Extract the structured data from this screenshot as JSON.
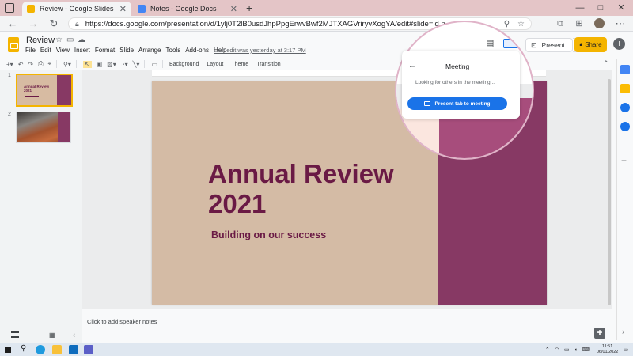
{
  "browser": {
    "tabs": [
      {
        "label": "Review - Google Slides",
        "active": true,
        "favicon_color": "#f4b400"
      },
      {
        "label": "Notes - Google Docs",
        "active": false,
        "favicon_color": "#4285f4"
      }
    ],
    "new_tab_label": "+",
    "url": "https://docs.google.com/presentation/d/1ylj0T2lB0usdJhpPpgErwvBwf2MJTXAGVriryvXogYA/edit#slide=id.p",
    "window_buttons": {
      "minimize": "—",
      "maximize": "□",
      "close": "✕"
    }
  },
  "app": {
    "doc_title": "Review",
    "menu": [
      "File",
      "Edit",
      "View",
      "Insert",
      "Format",
      "Slide",
      "Arrange",
      "Tools",
      "Add-ons",
      "Help"
    ],
    "last_edit": "Last edit was yesterday at 3:17 PM",
    "present_label": "Present",
    "share_label": "Share",
    "avatar_letter": "I",
    "toolbar_text": [
      "Background",
      "Layout",
      "Theme",
      "Transition"
    ],
    "brand_color": "#f4b400"
  },
  "filmstrip": {
    "slides": [
      {
        "number": "1",
        "title": "Annual Review 2021"
      },
      {
        "number": "2"
      }
    ]
  },
  "slide": {
    "title_line1": "Annual Review",
    "title_line2": "2021",
    "subtitle": "Building on our success",
    "bg_color": "#d4bba5",
    "accent_color": "#873964"
  },
  "notes_placeholder": "Click to add speaker notes",
  "meeting": {
    "title": "Meeting",
    "status": "Looking for others in the meeting...",
    "present_button": "Present tab to meeting"
  },
  "taskbar": {
    "time": "11:51",
    "date": "06/01/2022"
  }
}
